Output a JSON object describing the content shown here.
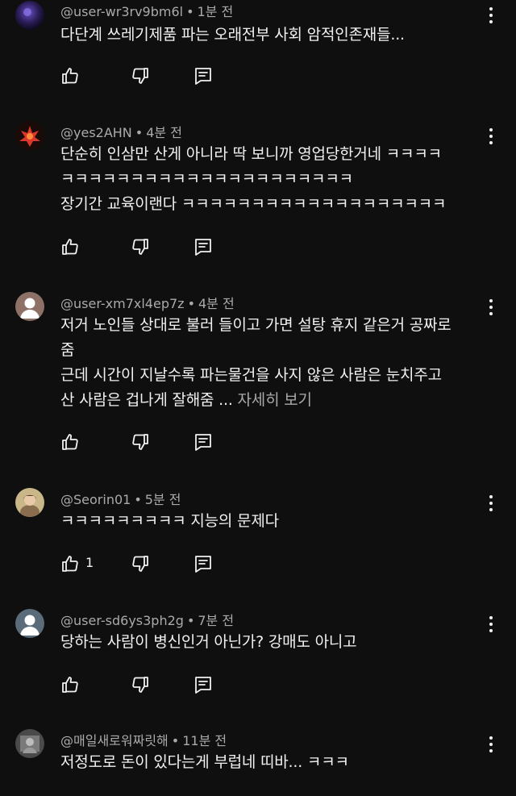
{
  "comments": [
    {
      "author": "@user-wr3rv9bm6l",
      "time": "1분 전",
      "lines": [
        "다단계 쓰레기제품 파는 오래전부 사회 암적인존재들..."
      ],
      "likes": ""
    },
    {
      "author": "@yes2AHN",
      "time": "4분 전",
      "lines": [
        "단순히 인삼만 산게 아니라 딱 보니까 영업당한거네 ㅋㅋㅋㅋ",
        "ㅋㅋㅋㅋㅋㅋㅋㅋㅋㅋㅋㅋㅋㅋㅋㅋㅋㅋㅋㅋㅋ",
        "장기간 교육이랜다 ㅋㅋㅋㅋㅋㅋㅋㅋㅋㅋㅋㅋㅋㅋㅋㅋㅋㅋㅋ"
      ],
      "likes": ""
    },
    {
      "author": "@user-xm7xl4ep7z",
      "time": "4분 전",
      "lines": [
        "저거 노인들 상대로 불러 들이고 가면 설탕 휴지 같은거 공짜로",
        "줌",
        "근데 시간이 지날수록 파는물건을 사지 않은 사람은 눈치주고",
        "산 사람은 겁나게 잘해줌 ..."
      ],
      "more": "자세히 보기",
      "likes": ""
    },
    {
      "author": "@Seorin01",
      "time": "5분 전",
      "lines": [
        "ㅋㅋㅋㅋㅋㅋㅋㅋㅋ 지능의 문제다"
      ],
      "likes": "1"
    },
    {
      "author": "@user-sd6ys3ph2g",
      "time": "7분 전",
      "lines": [
        "당하는 사람이 병신인거 아닌가? 강매도 아니고"
      ],
      "likes": ""
    },
    {
      "author": "@매일새로워짜릿해",
      "time": "11분 전",
      "lines": [
        "저정도로 돈이 있다는게 부럽네 띠바... ㅋㅋㅋ"
      ],
      "likes": ""
    }
  ],
  "separator": "•",
  "icons": {
    "like": "thumb-up-icon",
    "dislike": "thumb-down-icon",
    "reply": "reply-icon",
    "menu": "more-vertical-icon"
  },
  "colors": {
    "background": "#0f0f0f",
    "text": "#f1f1f1",
    "meta": "#aaaaaa"
  }
}
